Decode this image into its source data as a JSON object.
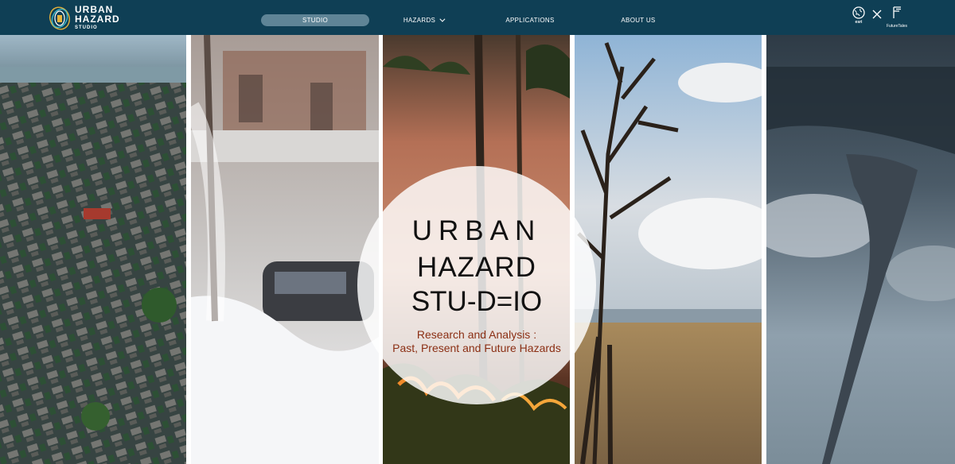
{
  "header": {
    "logo": {
      "line1": "URBAN",
      "line2": "HAZARD",
      "line3": "STUDIO"
    },
    "nav": [
      {
        "label": "STUDIO",
        "active": true
      },
      {
        "label": "HAZARDS",
        "active": false,
        "has_dropdown": true
      },
      {
        "label": "APPLICATIONS",
        "active": false
      },
      {
        "label": "ABOUT US",
        "active": false
      }
    ],
    "partners": {
      "esri_label": "esri",
      "futuretales_label": "FutureTales"
    },
    "background_color": "#0f3f55",
    "active_pill_color": "#5f8496"
  },
  "hero": {
    "panels": [
      "flood",
      "snowstorm",
      "wildfire",
      "drought",
      "tornado"
    ],
    "title_lines": [
      "URBAN",
      "HAZARD",
      "STU-D=IO"
    ],
    "subtitle_lines": [
      "Research and Analysis :",
      "Past, Present and Future Hazards"
    ],
    "subtitle_color": "#8b2f14"
  }
}
